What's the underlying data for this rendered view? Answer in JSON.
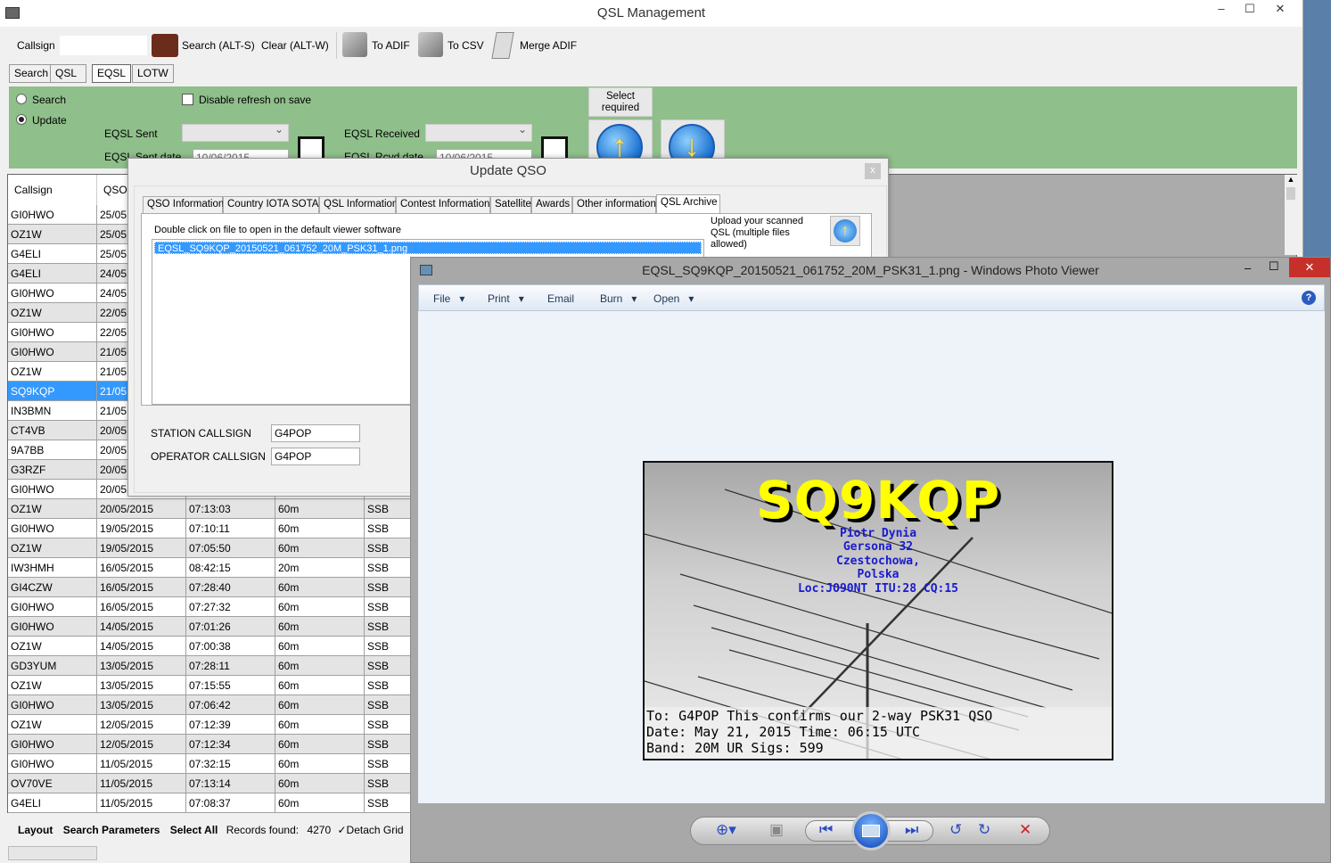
{
  "main": {
    "title": "QSL Management",
    "toolbar": {
      "callsign_label": "Callsign",
      "callsign_value": "",
      "search": "Search (ALT-S)",
      "clear": "Clear (ALT-W)",
      "to_adif": "To ADIF",
      "to_csv": "To CSV",
      "merge_adif": "Merge ADIF"
    },
    "tabs": [
      "Search",
      "QSL",
      "EQSL",
      "LOTW"
    ],
    "active_tab": "EQSL",
    "panel": {
      "radio_search": "Search",
      "radio_update": "Update",
      "selected_mode": "Update",
      "disable_refresh": "Disable refresh on save",
      "disable_refresh_checked": false,
      "eqsl_sent": "EQSL Sent",
      "eqsl_received": "EQSL Received",
      "eqsl_sent_date": "EQSL Sent date",
      "eqsl_rcvd_date": "EQSL Rcvd date",
      "date_value": "10/06/2015",
      "select_required": "Select required",
      "accent": "#8fbf8a"
    },
    "grid": {
      "headers": [
        "Callsign",
        "QSO"
      ],
      "rows": [
        [
          "GI0HWO",
          "25/05."
        ],
        [
          "OZ1W",
          "25/05."
        ],
        [
          "G4ELI",
          "25/05."
        ],
        [
          "G4ELI",
          "24/05."
        ],
        [
          "GI0HWO",
          "24/05."
        ],
        [
          "OZ1W",
          "22/05."
        ],
        [
          "GI0HWO",
          "22/05."
        ],
        [
          "GI0HWO",
          "21/05."
        ],
        [
          "OZ1W",
          "21/05."
        ],
        [
          "SQ9KQP",
          "21/05."
        ],
        [
          "IN3BMN",
          "21/05."
        ],
        [
          "CT4VB",
          "20/05."
        ],
        [
          "9A7BB",
          "20/05."
        ],
        [
          "G3RZF",
          "20/05."
        ],
        [
          "GI0HWO",
          "20/05."
        ],
        [
          "OZ1W",
          "20/05/2015",
          "07:13:03",
          "60m",
          "SSB"
        ],
        [
          "GI0HWO",
          "19/05/2015",
          "07:10:11",
          "60m",
          "SSB"
        ],
        [
          "OZ1W",
          "19/05/2015",
          "07:05:50",
          "60m",
          "SSB"
        ],
        [
          "IW3HMH",
          "16/05/2015",
          "08:42:15",
          "20m",
          "SSB"
        ],
        [
          "GI4CZW",
          "16/05/2015",
          "07:28:40",
          "60m",
          "SSB"
        ],
        [
          "GI0HWO",
          "16/05/2015",
          "07:27:32",
          "60m",
          "SSB"
        ],
        [
          "GI0HWO",
          "14/05/2015",
          "07:01:26",
          "60m",
          "SSB"
        ],
        [
          "OZ1W",
          "14/05/2015",
          "07:00:38",
          "60m",
          "SSB"
        ],
        [
          "GD3YUM",
          "13/05/2015",
          "07:28:11",
          "60m",
          "SSB"
        ],
        [
          "OZ1W",
          "13/05/2015",
          "07:15:55",
          "60m",
          "SSB"
        ],
        [
          "GI0HWO",
          "13/05/2015",
          "07:06:42",
          "60m",
          "SSB"
        ],
        [
          "OZ1W",
          "12/05/2015",
          "07:12:39",
          "60m",
          "SSB"
        ],
        [
          "GI0HWO",
          "12/05/2015",
          "07:12:34",
          "60m",
          "SSB"
        ],
        [
          "GI0HWO",
          "11/05/2015",
          "07:32:15",
          "60m",
          "SSB"
        ],
        [
          "OV70VE",
          "11/05/2015",
          "07:13:14",
          "60m",
          "SSB"
        ],
        [
          "G4ELI",
          "11/05/2015",
          "07:08:37",
          "60m",
          "SSB"
        ]
      ],
      "selected_callsign": "SQ9KQP",
      "selection_color": "#3399ff"
    },
    "status": {
      "layout": "Layout",
      "search_params": "Search Parameters",
      "select_all": "Select All",
      "records_label": "Records found:",
      "records": "4270",
      "detach": "Detach Grid"
    }
  },
  "dialog": {
    "title": "Update QSO",
    "close": "x",
    "tabs": [
      "QSO Information",
      "Country IOTA SOTA",
      "QSL Information",
      "Contest Information",
      "Satellite",
      "Awards",
      "Other information",
      "QSL Archive"
    ],
    "active_tab": "QSL Archive",
    "hint": "Double click on file to open in the default viewer software",
    "files": [
      "EQSL_SQ9KQP_20150521_061752_20M_PSK31_1.png"
    ],
    "upload_text": "Upload your scanned QSL (multiple files allowed)",
    "station_label": "STATION CALLSIGN",
    "station_value": "G4POP",
    "operator_label": "OPERATOR CALLSIGN",
    "operator_value": "G4POP"
  },
  "viewer": {
    "title": "EQSL_SQ9KQP_20150521_061752_20M_PSK31_1.png - Windows Photo Viewer",
    "menu": [
      "File",
      "Print",
      "Email",
      "Burn",
      "Open"
    ],
    "card": {
      "callsign": "SQ9KQP",
      "name": "Piotr Dynia",
      "street": "Gersona 32",
      "city": "Czestochowa,",
      "country": "Polska",
      "loc": "Loc:JO90NT ITU:28 CQ:15",
      "line1": "To: G4POP  This confirms our 2-way PSK31 QSO",
      "line2": "Date: May 21, 2015  Time: 06:15 UTC",
      "line3": "Band: 20M UR Sigs: 599"
    }
  }
}
